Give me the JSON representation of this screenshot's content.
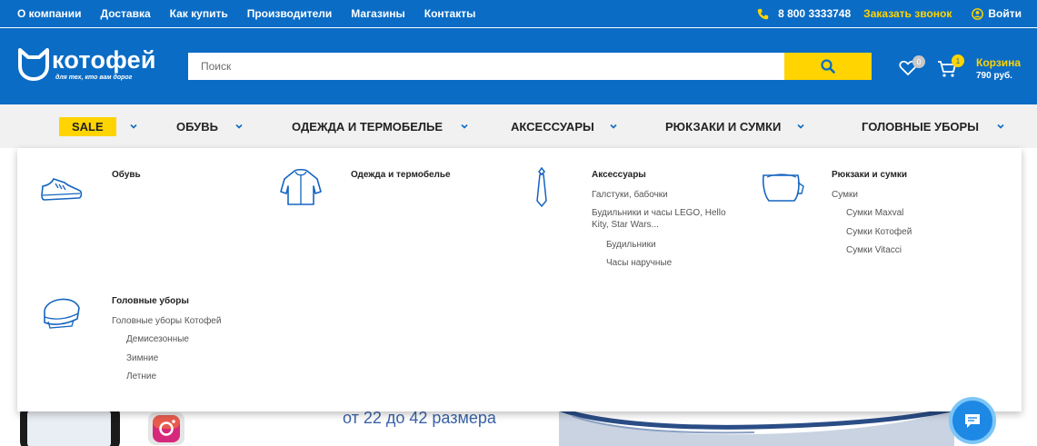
{
  "topnav": {
    "links": [
      "О компании",
      "Доставка",
      "Как купить",
      "Производители",
      "Магазины",
      "Контакты"
    ],
    "phone": "8 800 3333748",
    "callback": "Заказать звонок",
    "login": "Войти"
  },
  "header": {
    "logo_text": "котофей",
    "logo_tagline": "для тех, кто вам дорог",
    "search_placeholder": "Поиск",
    "wishlist_count": "0",
    "cart_count": "1",
    "cart_label": "Корзина",
    "cart_sum": "790 руб."
  },
  "categories": [
    {
      "label": "SALE"
    },
    {
      "label": "ОБУВЬ"
    },
    {
      "label": "ОДЕЖДА И ТЕРМОБЕЛЬЕ"
    },
    {
      "label": "АКСЕССУАРЫ"
    },
    {
      "label": "РЮКЗАКИ И СУМКИ"
    },
    {
      "label": "ГОЛОВНЫЕ УБОРЫ"
    }
  ],
  "dropdown": {
    "shoes": {
      "title": "Обувь",
      "icon": "shoe-icon"
    },
    "clothes": {
      "title": "Одежда и термобелье",
      "icon": "jacket-icon"
    },
    "accessories": {
      "title": "Аксессуары",
      "icon": "tie-icon",
      "links": [
        "Галстуки, бабочки",
        "Будильники и часы LEGO, Hello",
        "Kity, Star Wars...",
        "Будильники",
        "Часы наручные"
      ]
    },
    "bags": {
      "title": "Рюкзаки и сумки",
      "icon": "bag-icon",
      "links": [
        "Сумки",
        "Сумки Maxval",
        "Сумки Котофей",
        "Сумки Vitacci"
      ]
    },
    "hats": {
      "title": "Головные уборы",
      "icon": "hat-icon",
      "links": [
        "Головные уборы Котофей",
        "Демисезонные",
        "Зимние",
        "Летние"
      ]
    }
  },
  "banner": {
    "text": "от 22 до 42 размера"
  },
  "colors": {
    "brand_blue": "#0a6cc5",
    "accent_yellow": "#ffd400",
    "nav_gray": "#f1f1f1"
  }
}
